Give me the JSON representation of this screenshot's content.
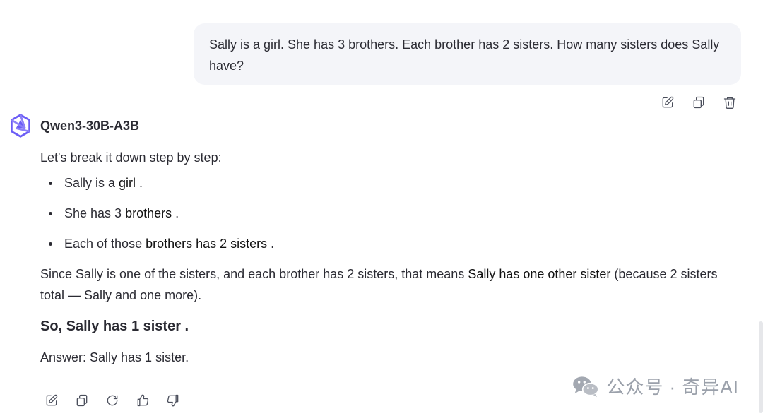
{
  "user_message": {
    "text": "Sally is a girl. She has 3 brothers. Each brother has 2 sisters. How many sisters does Sally have?"
  },
  "user_actions": {
    "icons": [
      "edit-icon",
      "copy-icon",
      "delete-icon"
    ]
  },
  "assistant": {
    "model_name": "Qwen3-30B-A3B",
    "intro": "Let's break it down step by step:",
    "bullets": [
      {
        "prefix": "Sally is a ",
        "highlight": "girl",
        "suffix": " ."
      },
      {
        "prefix": "She has 3 ",
        "highlight": "brothers",
        "suffix": " ."
      },
      {
        "prefix": "Each of those ",
        "highlight": "brothers has 2 sisters",
        "suffix": " ."
      }
    ],
    "reasoning_prefix": "Since Sally is one of the sisters, and each brother has 2 sisters, that means ",
    "reasoning_highlight": "Sally has one other sister",
    "reasoning_suffix": " (because 2 sisters total — Sally and one more).",
    "conclusion": "So, Sally has 1 sister .",
    "final_answer": "Answer: Sally has 1 sister."
  },
  "assistant_actions": {
    "icons": [
      "edit-icon",
      "copy-icon",
      "regenerate-icon",
      "thumbs-up-icon",
      "thumbs-down-icon"
    ]
  },
  "watermark": {
    "text": "公众号 · 奇异AI"
  },
  "colors": {
    "bubble_bg": "#f4f5f9",
    "text": "#2b2b33",
    "icon": "#4b4f5c",
    "logo_purple": "#6b5cf6",
    "watermark": "#9aa0aa"
  }
}
